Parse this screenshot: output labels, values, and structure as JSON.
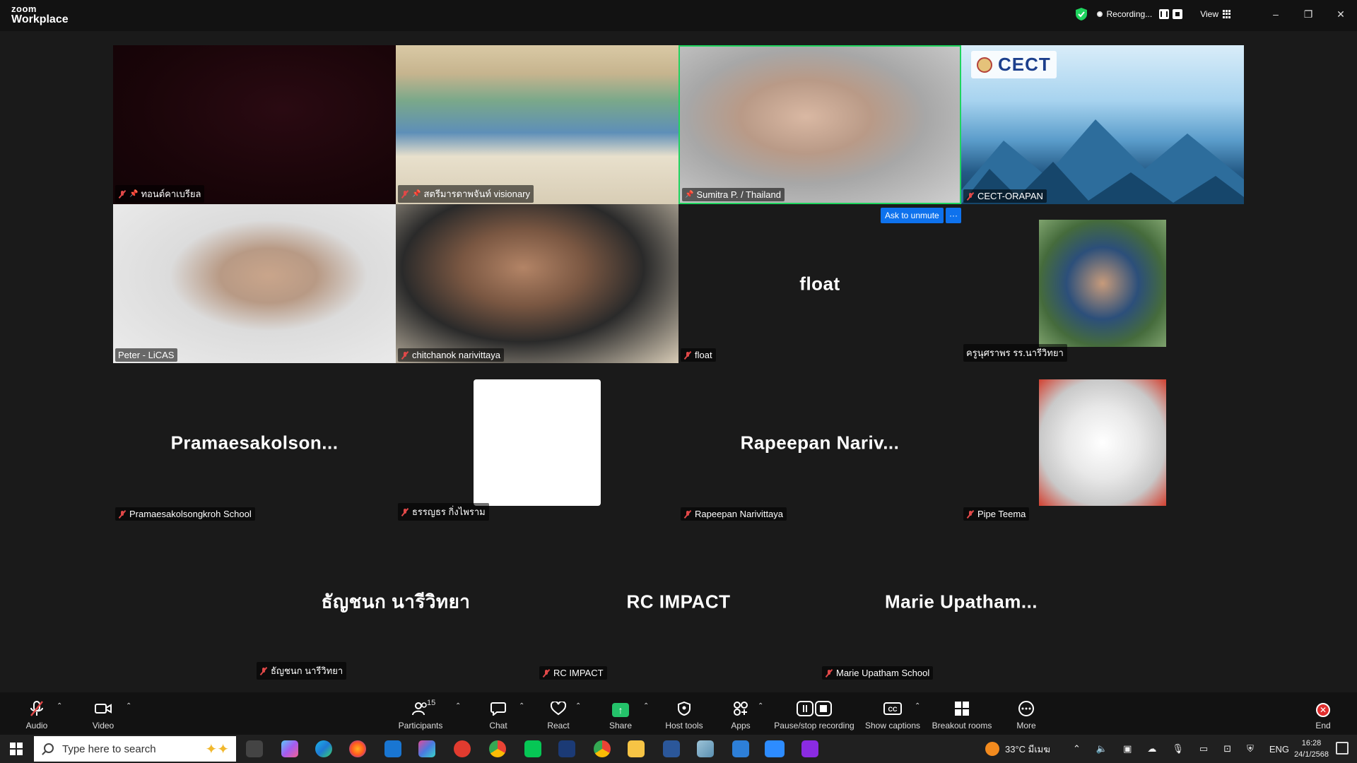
{
  "app": {
    "brand_top": "zoom",
    "brand_bottom": "Workplace"
  },
  "titlebar": {
    "recording_label": "Recording...",
    "view_label": "View",
    "minimize": "–",
    "restore": "❐",
    "close": "✕"
  },
  "tiles": [
    {
      "name": "ทอนต์คาเบรียล",
      "pinned": true,
      "muted": true
    },
    {
      "name": "สตรีมารดาพจันท์ visionary",
      "pinned": true,
      "muted": true
    },
    {
      "name": "Sumitra P. / Thailand",
      "pinned": true,
      "muted": false,
      "speaking": true
    },
    {
      "name": "CECT-ORAPAN",
      "pinned": false,
      "muted": true,
      "logo_text": "CECT"
    },
    {
      "name": "Peter - LiCAS",
      "pinned": false,
      "muted": false
    },
    {
      "name": "chitchanok narivittaya",
      "pinned": false,
      "muted": true
    },
    {
      "name": "float",
      "pinned": false,
      "muted": true,
      "display": "float"
    },
    {
      "name": "ครูนุศราพร รร.นารีวิทยา",
      "pinned": false,
      "muted": false
    },
    {
      "name": "Pramaesakolsongkroh School",
      "pinned": false,
      "muted": true,
      "display": "Pramaesakolson..."
    },
    {
      "name": "ธรรญธร กิ่งไพราม",
      "pinned": false,
      "muted": true
    },
    {
      "name": "Rapeepan Narivittaya",
      "pinned": false,
      "muted": true,
      "display": "Rapeepan  Nariv..."
    },
    {
      "name": "Pipe Teema",
      "pinned": false,
      "muted": true
    },
    {
      "name": "ธัญชนก นารีวิทยา",
      "pinned": false,
      "muted": true,
      "display": "ธัญชนก นารีวิทยา"
    },
    {
      "name": "RC IMPACT",
      "pinned": false,
      "muted": true,
      "display": "RC IMPACT"
    },
    {
      "name": "Marie Upatham School",
      "pinned": false,
      "muted": true,
      "display": "Marie  Upatham..."
    }
  ],
  "ask_unmute": {
    "label": "Ask to unmute",
    "more": "···"
  },
  "toolbar": {
    "audio": "Audio",
    "video": "Video",
    "participants": "Participants",
    "participant_count": "15",
    "chat": "Chat",
    "react": "React",
    "share": "Share",
    "host_tools": "Host tools",
    "apps": "Apps",
    "pause_stop_recording": "Pause/stop recording",
    "show_captions": "Show captions",
    "breakout_rooms": "Breakout rooms",
    "more": "More",
    "end": "End"
  },
  "taskbar": {
    "search_placeholder": "Type here to search",
    "weather": "33°C มีเมฆ",
    "language": "ENG",
    "time": "16:28",
    "date": "24/1/2568"
  },
  "colors": {
    "accent": "#0e72ed",
    "speaking": "#1fd45e",
    "muted": "#e04848",
    "share": "#24c26a",
    "end": "#e02d2d"
  }
}
